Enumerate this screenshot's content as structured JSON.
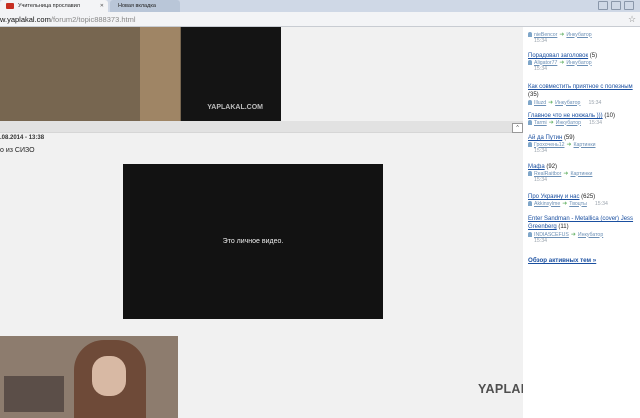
{
  "browser": {
    "tabs": [
      {
        "title": "Учительница прославил",
        "active": true
      },
      {
        "title": "Новая вкладка",
        "active": false
      }
    ],
    "url_host": "w.yaplakal.com",
    "url_path": "/forum2/topic888373.html"
  },
  "post": {
    "date": ".08.2014 - 13:38",
    "text": "о из СИЗО",
    "top_image_watermark": "YAPLAKAL.COM",
    "video_label": "Это личное видео.",
    "up_button": "^"
  },
  "watermark": "YAPLAKAL.COM",
  "sidebar": {
    "items": [
      {
        "title": "",
        "count": "",
        "user1": "nieBencor",
        "user2": "Инкубатор",
        "time": "15:34"
      },
      {
        "title": "Порадовал заголовок",
        "count": "(5)",
        "user1": "Aligator77",
        "user2": "Инкубатор",
        "time": "15:34"
      },
      {
        "title": "Как совместить приятное с полезным",
        "count": "(35)",
        "user1": "Illuzd",
        "user2": "Инкубатор",
        "time": "15:34"
      },
      {
        "title": "Главное что не нокжаль )))",
        "count": "(10)",
        "user1": "Tarmi",
        "user2": "Инкубатор",
        "time": "15:34"
      },
      {
        "title": "Ай да Путин",
        "count": "(59)",
        "user1": "Грохочень12",
        "user2": "Картинки",
        "time": "15:34"
      },
      {
        "title": "Мафа",
        "count": "(92)",
        "user1": "RealRaitbor",
        "user2": "Картинки",
        "time": "15:34"
      },
      {
        "title": "Про Украину и нас",
        "count": "(625)",
        "user1": "Akkinsylme",
        "user2": "Твоцты",
        "time": "15:34"
      },
      {
        "title": "Enter Sandman - Metallica (cover) Jess Greenberg",
        "count": "(11)",
        "user1": "INDIASCEFUS",
        "user2": "Инкубатор",
        "time": "15:34"
      }
    ],
    "overview_link": "Обзор активных тем »"
  },
  "colors": {
    "link": "#1a4fa0",
    "tabstrip": "#cfd8e6",
    "video_bg": "#121212"
  }
}
